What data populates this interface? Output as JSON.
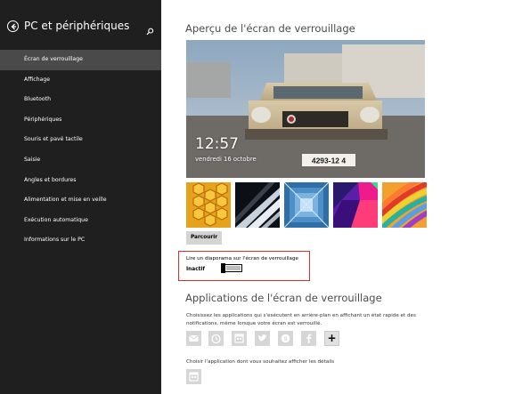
{
  "sidebar": {
    "title": "PC et périphériques",
    "items": [
      {
        "label": "Écran de verrouillage",
        "active": true
      },
      {
        "label": "Affichage"
      },
      {
        "label": "Bluetooth"
      },
      {
        "label": "Périphériques"
      },
      {
        "label": "Souris et pavé tactile"
      },
      {
        "label": "Saisie"
      },
      {
        "label": "Angles et bordures"
      },
      {
        "label": "Alimentation et mise en veille"
      },
      {
        "label": "Exécution automatique"
      },
      {
        "label": "Informations sur le PC"
      }
    ]
  },
  "preview": {
    "heading": "Aperçu de l'écran de verrouillage",
    "time": "12:57",
    "date": "vendredi 16 octobre",
    "plate": "4293-12 4"
  },
  "thumbnails": [
    {
      "name": "honeycomb"
    },
    {
      "name": "piano-keys"
    },
    {
      "name": "tunnel"
    },
    {
      "name": "geometric-color"
    },
    {
      "name": "colored-pencils"
    }
  ],
  "browse_button": "Parcourir",
  "slideshow": {
    "label": "Lire un diaporama sur l'écran de verrouillage",
    "state": "Inactif",
    "on": false
  },
  "apps": {
    "heading": "Applications de l'écran de verrouillage",
    "description": "Choisissez les applications qui s'exécutent en arrière-plan en affichant un état rapide et des notifications, même lorsque votre écran est verrouillé.",
    "icons": [
      "mail-icon",
      "alarm-icon",
      "calendar-icon",
      "twitter-icon",
      "skype-icon",
      "facebook-icon",
      "plus-icon"
    ],
    "plus_label": "+",
    "details_label": "Choisir l'application dont vous souhaitez afficher les détails"
  }
}
